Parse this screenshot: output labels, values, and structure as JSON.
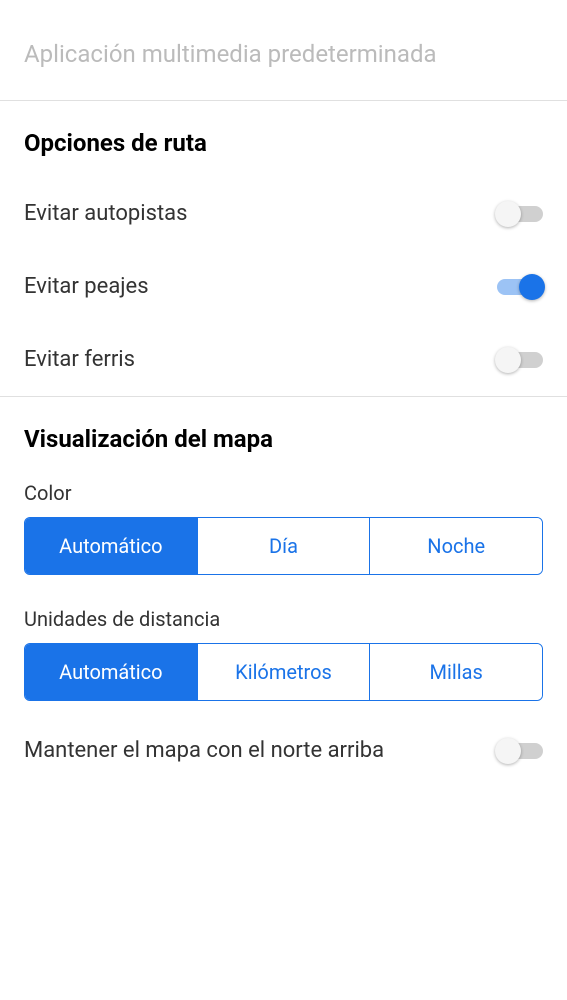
{
  "topItem": {
    "label": "Aplicación multimedia predeterminada"
  },
  "routeOptions": {
    "header": "Opciones de ruta",
    "avoidHighways": {
      "label": "Evitar autopistas",
      "on": false
    },
    "avoidTolls": {
      "label": "Evitar peajes",
      "on": true
    },
    "avoidFerries": {
      "label": "Evitar ferris",
      "on": false
    }
  },
  "mapDisplay": {
    "header": "Visualización del mapa",
    "color": {
      "label": "Color",
      "options": [
        "Automático",
        "Día",
        "Noche"
      ],
      "selected": 0
    },
    "distanceUnits": {
      "label": "Unidades de distancia",
      "options": [
        "Automático",
        "Kilómetros",
        "Millas"
      ],
      "selected": 0
    },
    "keepNorthUp": {
      "label": "Mantener el mapa con el norte arriba",
      "on": false
    }
  }
}
